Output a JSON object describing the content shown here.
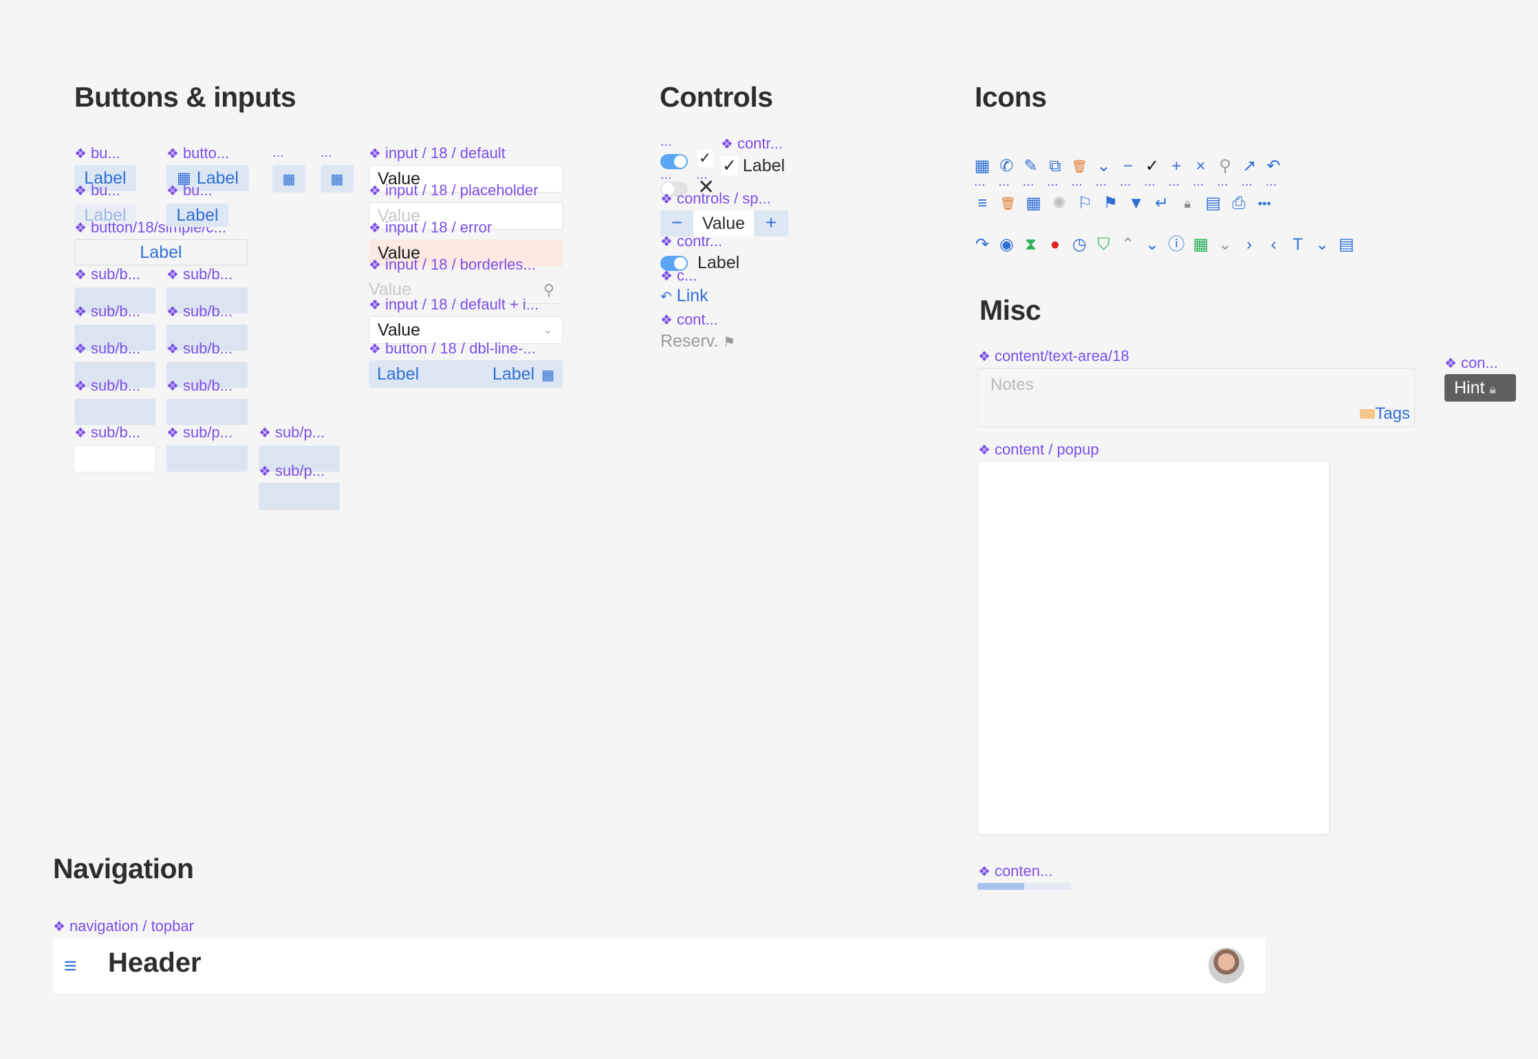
{
  "sections": {
    "buttons_inputs": "Buttons & inputs",
    "controls": "Controls",
    "icons": "Icons",
    "misc": "Misc",
    "navigation": "Navigation"
  },
  "component_labels": {
    "bu1": "bu...",
    "butto": "butto...",
    "dots": "...",
    "bu2": "bu...",
    "bu3": "bu...",
    "simple": "button/18/simple/c...",
    "sub1": "sub/b...",
    "subp": "sub/p...",
    "input_default": "input / 18 / default",
    "input_placeholder": "input / 18 / placeholder",
    "input_error": "input / 18 / error",
    "input_borderless": "input / 18 / borderles...",
    "input_default_i": "input / 18 / default + i...",
    "button_dbl": "button / 18 / dbl-line-...",
    "contr1": "contr...",
    "controls_sp": "controls / sp...",
    "contr2": "contr...",
    "c": "c...",
    "cont": "cont...",
    "text_area": "content/text-area/18",
    "popup": "content / popup",
    "con_hint": "con...",
    "conten": "conten...",
    "topbar": "navigation / topbar"
  },
  "buttons": {
    "label": "Label",
    "value": "Value",
    "link": "Link",
    "reserv": "Reserv.",
    "hint": "Hint",
    "notes_placeholder": "Notes",
    "tags": "Tags"
  },
  "icons_row1": [
    "calendar-icon",
    "phone-icon",
    "pencil-icon",
    "copy-icon",
    "trash-icon",
    "double-chevron-down-icon",
    "minus-icon",
    "check-icon",
    "plus-icon",
    "close-icon",
    "search-icon",
    "arrow-up-right-icon",
    "undo-icon"
  ],
  "icons_row2": [
    "menu-icon",
    "trash-icon",
    "grid-icon",
    "loading-icon",
    "flag-outline-icon",
    "flag-icon",
    "filter-icon",
    "return-icon",
    "lock-icon",
    "document-icon",
    "print-icon",
    "more-icon"
  ],
  "icons_row3": [
    "redo-icon",
    "eye-icon",
    "hourglass-icon",
    "record-icon",
    "clock-icon",
    "shield-icon",
    "chevron-up-icon",
    "chevron-down-icon",
    "info-icon",
    "table-icon",
    "chevron-down-light-icon",
    "chevron-right-icon",
    "chevron-left-icon",
    "text-icon",
    "chevron-down-icon",
    "document-icon"
  ],
  "navigation": {
    "header_title": "Header"
  },
  "progress": {
    "value": 0.5
  },
  "colors": {
    "accent": "#2f6fd6",
    "component_label": "#7b4fe6",
    "background": "#f5f5f5",
    "button_bg": "#dde6f3",
    "error_bg": "#fbe9e2"
  }
}
